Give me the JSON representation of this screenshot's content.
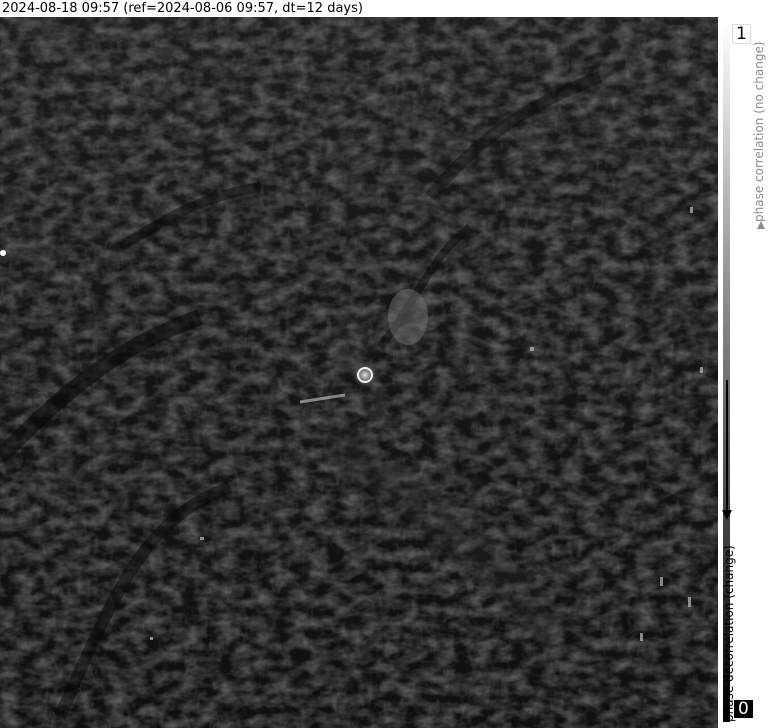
{
  "title": "2024-08-18 09:57 (ref=2024-08-06 09:57, dt=12 days)",
  "colorbar": {
    "max_label": "1",
    "min_label": "0",
    "upper_text": "phase correlation (no change)",
    "lower_text": "phase decorrelation (change)",
    "gradient_top_color": "#ffffff",
    "gradient_bottom_color": "#000000"
  },
  "image": {
    "description_colors": {
      "background": "#121212",
      "texture": "#5a5a5a",
      "highlight": "#d8d8d8"
    }
  }
}
